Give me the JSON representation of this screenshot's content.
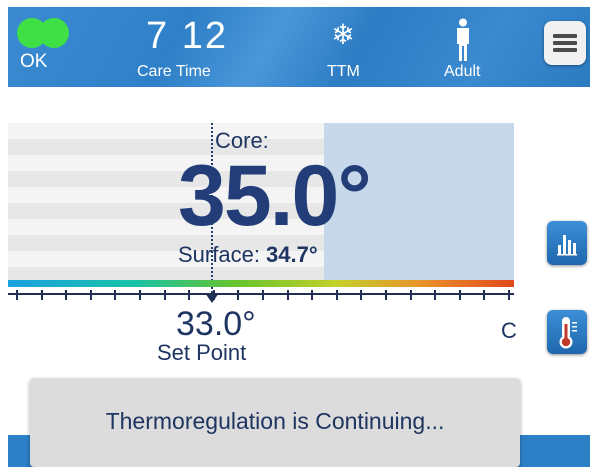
{
  "header": {
    "status_label": "OK",
    "care_time_value": "7 12",
    "care_time_label": "Care Time",
    "mode_label": "TTM",
    "patient_label": "Adult"
  },
  "icons": {
    "status": "status-ok-indicator",
    "mode": "snowflake-icon",
    "patient": "adult-person-icon",
    "menu": "hamburger-menu-icon",
    "trend": "bar-chart-icon",
    "temperature": "thermometer-icon"
  },
  "temperature": {
    "core_label": "Core:",
    "core_value": "35.0°",
    "surface_label": "Surface: ",
    "surface_value": "34.7°",
    "set_point_value": "33.0°",
    "set_point_label": "Set Point",
    "unit": "C"
  },
  "message": {
    "text": "Thermoregulation is Continuing..."
  },
  "colors": {
    "header_blue": "#2f80c8",
    "status_green": "#3ee046",
    "core_text": "#223d78",
    "measured_band": "#c6d8e9",
    "toast_bg": "#dcdcdc"
  }
}
